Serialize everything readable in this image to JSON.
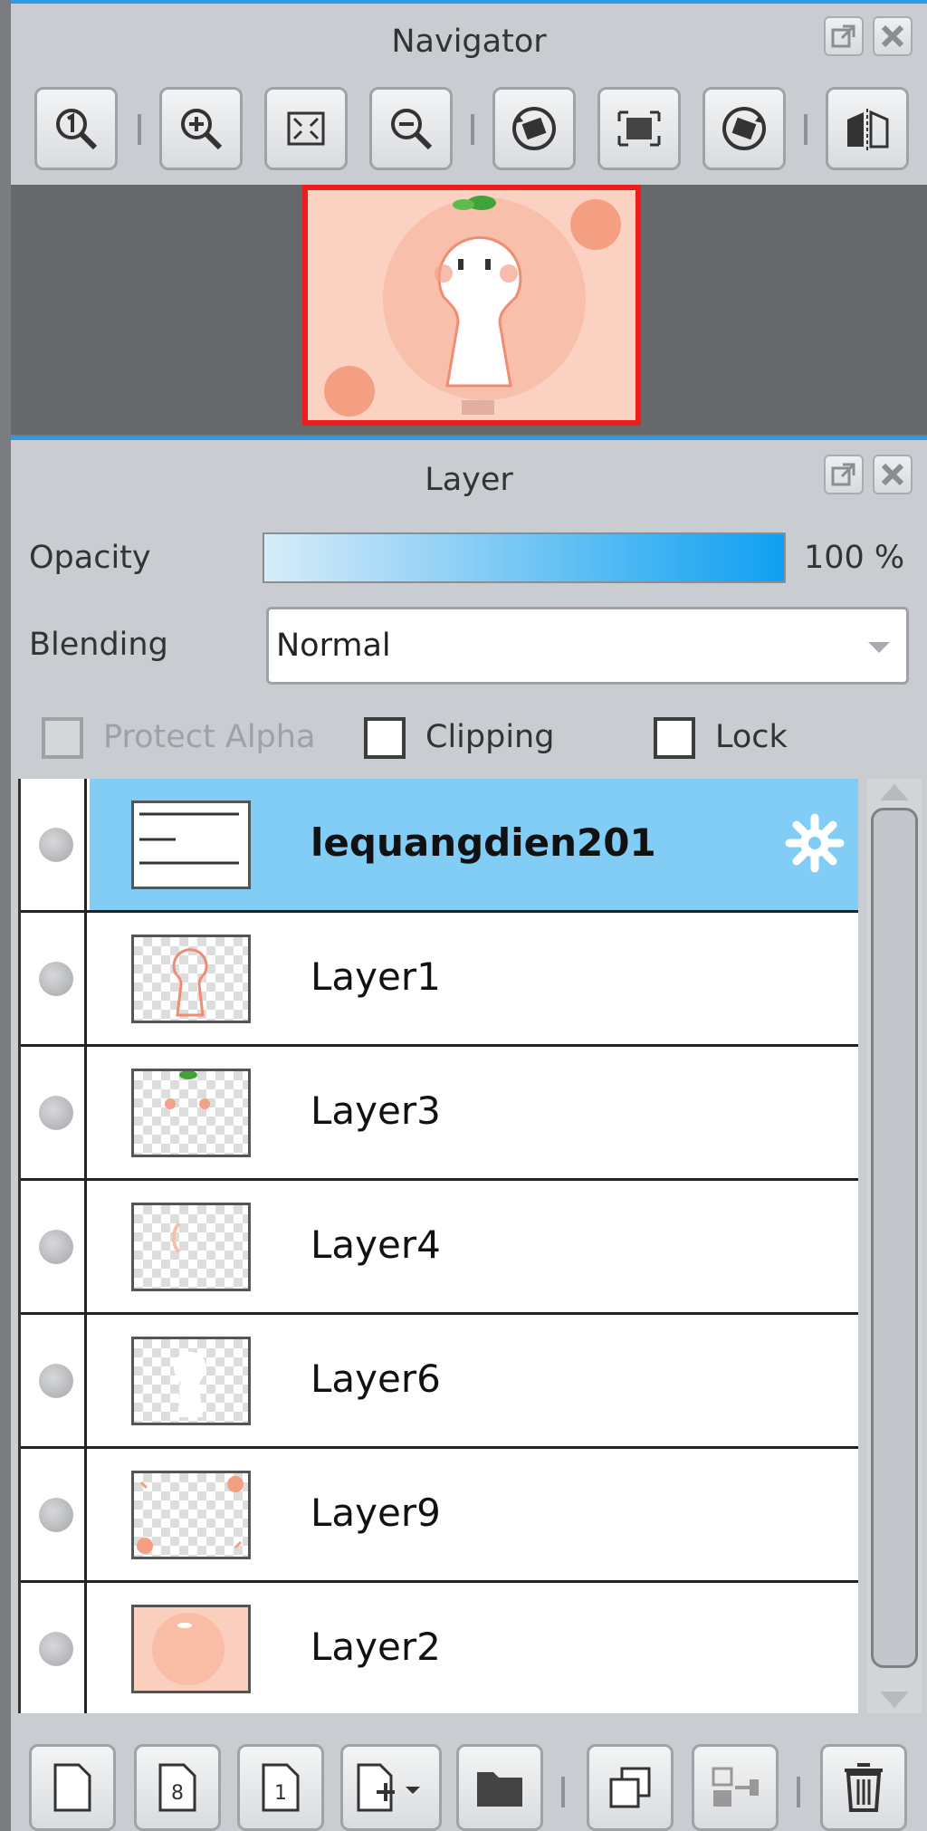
{
  "navigator": {
    "title": "Navigator",
    "toolbar": [
      {
        "name": "actual-size-icon"
      },
      {
        "name": "zoom-in-icon"
      },
      {
        "name": "fit-window-icon"
      },
      {
        "name": "zoom-out-icon"
      },
      {
        "name": "rotate-left-icon"
      },
      {
        "name": "reset-rotation-icon"
      },
      {
        "name": "rotate-right-icon"
      },
      {
        "name": "flip-horizontal-icon"
      }
    ]
  },
  "layer_panel": {
    "title": "Layer",
    "opacity_label": "Opacity",
    "opacity_value": "100 %",
    "opacity_fraction": 1.0,
    "blending_label": "Blending",
    "blending_value": "Normal",
    "protect_alpha_label": "Protect Alpha",
    "clipping_label": "Clipping",
    "lock_label": "Lock",
    "layers": [
      {
        "name": "lequangdien201",
        "selected": true
      },
      {
        "name": "Layer1",
        "selected": false
      },
      {
        "name": "Layer3",
        "selected": false
      },
      {
        "name": "Layer4",
        "selected": false
      },
      {
        "name": "Layer6",
        "selected": false
      },
      {
        "name": "Layer9",
        "selected": false
      },
      {
        "name": "Layer2",
        "selected": false
      }
    ],
    "bottom_tools": [
      {
        "name": "new-layer-icon"
      },
      {
        "name": "new-8bit-layer-icon"
      },
      {
        "name": "new-1bit-layer-icon"
      },
      {
        "name": "add-layer-menu-icon"
      },
      {
        "name": "new-folder-icon"
      },
      {
        "name": "duplicate-layer-icon"
      },
      {
        "name": "merge-down-icon"
      },
      {
        "name": "delete-layer-icon"
      }
    ]
  },
  "colors": {
    "accent": "#2f9be2",
    "selected_row": "#82cdf6",
    "thumb_border": "#ee1c1c"
  }
}
